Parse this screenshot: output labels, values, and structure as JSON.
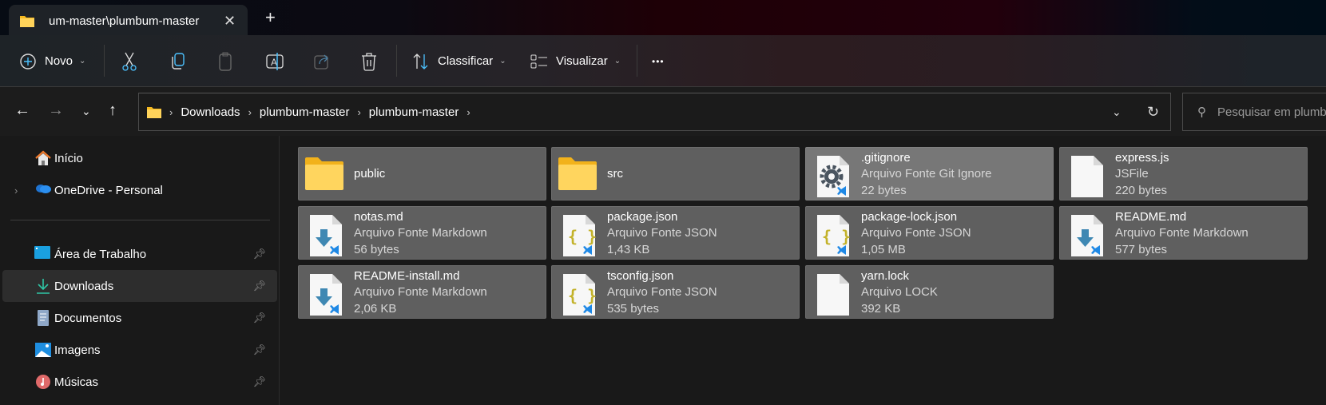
{
  "tab": {
    "title": "um-master\\plumbum-master",
    "close": "✕",
    "new_tab": "+"
  },
  "toolbar": {
    "new_label": "Novo",
    "sort_label": "Classificar",
    "view_label": "Visualizar",
    "more": "•••"
  },
  "address": {
    "crumbs": [
      "Downloads",
      "plumbum-master",
      "plumbum-master"
    ],
    "search_placeholder": "Pesquisar em plumbum-master"
  },
  "sidebar": {
    "items": [
      {
        "label": "Início",
        "icon": "home-icon"
      },
      {
        "label": "OneDrive - Personal",
        "icon": "onedrive-icon"
      },
      {
        "label": "Área de Trabalho",
        "icon": "desktop-icon",
        "pinned": true
      },
      {
        "label": "Downloads",
        "icon": "download-icon",
        "pinned": true,
        "selected": true
      },
      {
        "label": "Documentos",
        "icon": "documents-icon",
        "pinned": true
      },
      {
        "label": "Imagens",
        "icon": "pictures-icon",
        "pinned": true
      },
      {
        "label": "Músicas",
        "icon": "music-icon",
        "pinned": true
      }
    ]
  },
  "files": [
    {
      "name": "public",
      "kind": "folder"
    },
    {
      "name": "src",
      "kind": "folder"
    },
    {
      "name": ".gitignore",
      "type": "Arquivo Fonte Git Ignore",
      "size": "22 bytes",
      "kind": "gear",
      "selected": true
    },
    {
      "name": "express.js",
      "type": "JSFile",
      "size": "220 bytes",
      "kind": "blank"
    },
    {
      "name": "notas.md",
      "type": "Arquivo Fonte Markdown",
      "size": "56 bytes",
      "kind": "md"
    },
    {
      "name": "package.json",
      "type": "Arquivo Fonte JSON",
      "size": "1,43 KB",
      "kind": "json"
    },
    {
      "name": "package-lock.json",
      "type": "Arquivo Fonte JSON",
      "size": "1,05 MB",
      "kind": "json"
    },
    {
      "name": "README.md",
      "type": "Arquivo Fonte Markdown",
      "size": "577 bytes",
      "kind": "md"
    },
    {
      "name": "README-install.md",
      "type": "Arquivo Fonte Markdown",
      "size": "2,06 KB",
      "kind": "md"
    },
    {
      "name": "tsconfig.json",
      "type": "Arquivo Fonte JSON",
      "size": "535 bytes",
      "kind": "json"
    },
    {
      "name": "yarn.lock",
      "type": "Arquivo LOCK",
      "size": "392 KB",
      "kind": "blank"
    }
  ],
  "colors": {
    "accent": "#4cc2ff",
    "folder": "#f8c33c",
    "markdown": "#4a8ab0",
    "json": "#c5b72e",
    "vscode": "#1e88e5"
  }
}
